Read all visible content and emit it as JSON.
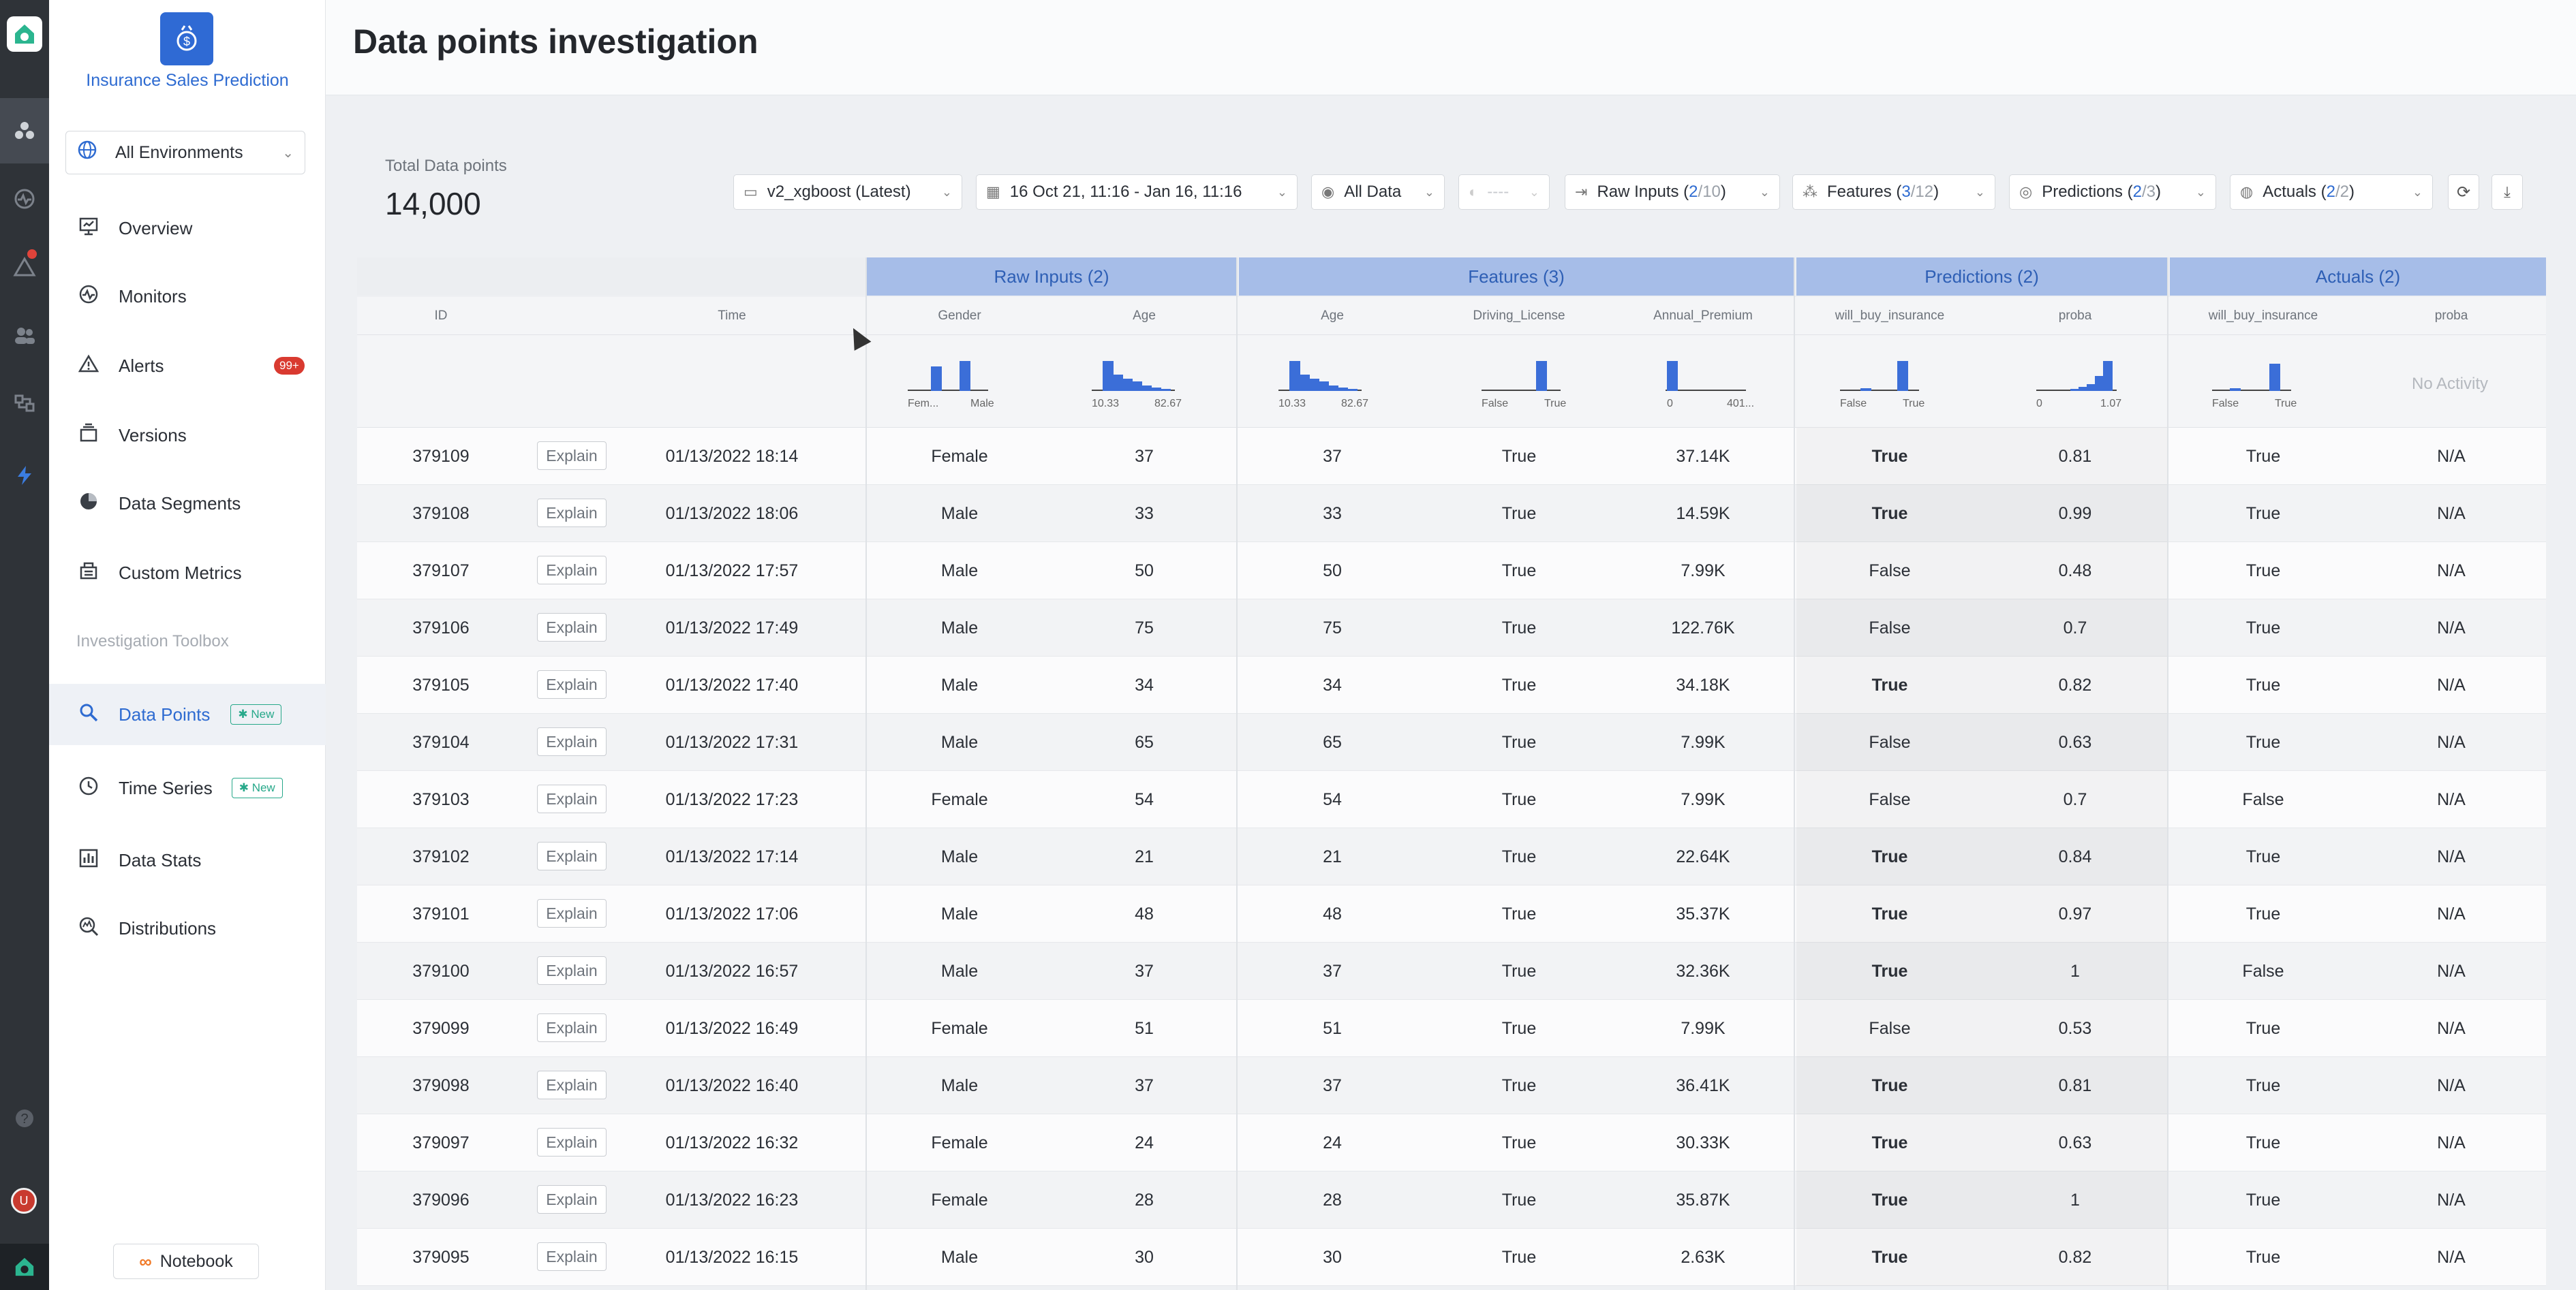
{
  "app": {
    "model_name": "Insurance Sales Prediction",
    "environment": "All Environments"
  },
  "nav": {
    "items": [
      {
        "label": "Overview",
        "icon": "monitor-icon"
      },
      {
        "label": "Monitors",
        "icon": "pulse-icon"
      },
      {
        "label": "Alerts",
        "icon": "warning-icon",
        "badge": "99+"
      },
      {
        "label": "Versions",
        "icon": "versions-icon"
      },
      {
        "label": "Data Segments",
        "icon": "pie-icon"
      },
      {
        "label": "Custom Metrics",
        "icon": "metrics-icon"
      }
    ],
    "section_label": "Investigation Toolbox",
    "toolbox": [
      {
        "label": "Data Points",
        "icon": "search-data-icon",
        "badge": "New",
        "active": true
      },
      {
        "label": "Time Series",
        "icon": "clock-icon",
        "badge": "New"
      },
      {
        "label": "Data Stats",
        "icon": "bar-chart-icon"
      },
      {
        "label": "Distributions",
        "icon": "distribution-icon"
      }
    ],
    "notebook_label": "Notebook"
  },
  "header": {
    "title": "Data points investigation"
  },
  "summary": {
    "total_label": "Total Data points",
    "total_value": "14,000"
  },
  "toolbar": {
    "version": "v2_xgboost (Latest)",
    "date_range": "16 Oct 21, 11:16 - Jan 16, 11:16",
    "data_filter": "All Data",
    "segment": "----",
    "raw_inputs": {
      "label": "Raw Inputs",
      "open": "(",
      "sel": "2",
      "total": "/10",
      "close": ")"
    },
    "features": {
      "label": "Features",
      "open": "(",
      "sel": "3",
      "total": "/12",
      "close": ")"
    },
    "predictions": {
      "label": "Predictions",
      "open": "(",
      "sel": "2",
      "total": "/3",
      "close": ")"
    },
    "actuals": {
      "label": "Actuals",
      "open": "(",
      "sel": "2",
      "total": "/2",
      "close": ")"
    }
  },
  "table": {
    "groups": [
      "Raw Inputs (2)",
      "Features (3)",
      "Predictions (2)",
      "Actuals (2)"
    ],
    "columns": [
      "ID",
      "Time",
      "Gender",
      "Age",
      "Age",
      "Driving_License",
      "Annual_Premium",
      "will_buy_insurance",
      "proba",
      "will_buy_insurance",
      "proba"
    ],
    "explain_label": "Explain",
    "no_activity": "No Activity",
    "hist_labels": {
      "gender": [
        "Fem...",
        "Male"
      ],
      "age": [
        "10.33",
        "82.67"
      ],
      "age2": [
        "10.33",
        "82.67"
      ],
      "license": [
        "False",
        "True"
      ],
      "premium": [
        "0",
        "401..."
      ],
      "pred": [
        "False",
        "True"
      ],
      "proba": [
        "0",
        "1.07"
      ],
      "actual": [
        "False",
        "True"
      ]
    },
    "rows": [
      [
        "379109",
        "01/13/2022 18:14",
        "Female",
        "37",
        "37",
        "True",
        "37.14K",
        "True",
        "0.81",
        "True",
        "N/A"
      ],
      [
        "379108",
        "01/13/2022 18:06",
        "Male",
        "33",
        "33",
        "True",
        "14.59K",
        "True",
        "0.99",
        "True",
        "N/A"
      ],
      [
        "379107",
        "01/13/2022 17:57",
        "Male",
        "50",
        "50",
        "True",
        "7.99K",
        "False",
        "0.48",
        "True",
        "N/A"
      ],
      [
        "379106",
        "01/13/2022 17:49",
        "Male",
        "75",
        "75",
        "True",
        "122.76K",
        "False",
        "0.7",
        "True",
        "N/A"
      ],
      [
        "379105",
        "01/13/2022 17:40",
        "Male",
        "34",
        "34",
        "True",
        "34.18K",
        "True",
        "0.82",
        "True",
        "N/A"
      ],
      [
        "379104",
        "01/13/2022 17:31",
        "Male",
        "65",
        "65",
        "True",
        "7.99K",
        "False",
        "0.63",
        "True",
        "N/A"
      ],
      [
        "379103",
        "01/13/2022 17:23",
        "Female",
        "54",
        "54",
        "True",
        "7.99K",
        "False",
        "0.7",
        "False",
        "N/A"
      ],
      [
        "379102",
        "01/13/2022 17:14",
        "Male",
        "21",
        "21",
        "True",
        "22.64K",
        "True",
        "0.84",
        "True",
        "N/A"
      ],
      [
        "379101",
        "01/13/2022 17:06",
        "Male",
        "48",
        "48",
        "True",
        "35.37K",
        "True",
        "0.97",
        "True",
        "N/A"
      ],
      [
        "379100",
        "01/13/2022 16:57",
        "Male",
        "37",
        "37",
        "True",
        "32.36K",
        "True",
        "1",
        "False",
        "N/A"
      ],
      [
        "379099",
        "01/13/2022 16:49",
        "Female",
        "51",
        "51",
        "True",
        "7.99K",
        "False",
        "0.53",
        "True",
        "N/A"
      ],
      [
        "379098",
        "01/13/2022 16:40",
        "Male",
        "37",
        "37",
        "True",
        "36.41K",
        "True",
        "0.81",
        "True",
        "N/A"
      ],
      [
        "379097",
        "01/13/2022 16:32",
        "Female",
        "24",
        "24",
        "True",
        "30.33K",
        "True",
        "0.63",
        "True",
        "N/A"
      ],
      [
        "379096",
        "01/13/2022 16:23",
        "Female",
        "28",
        "28",
        "True",
        "35.87K",
        "True",
        "1",
        "True",
        "N/A"
      ],
      [
        "379095",
        "01/13/2022 16:15",
        "Male",
        "30",
        "30",
        "True",
        "2.63K",
        "True",
        "0.82",
        "True",
        "N/A"
      ]
    ]
  },
  "colors": {
    "accent": "#2e6bd1",
    "group_header": "#a6bde8",
    "histogram_bar": "#3b6ed8",
    "alert_badge": "#d93a30",
    "new_badge": "#27a88a"
  }
}
